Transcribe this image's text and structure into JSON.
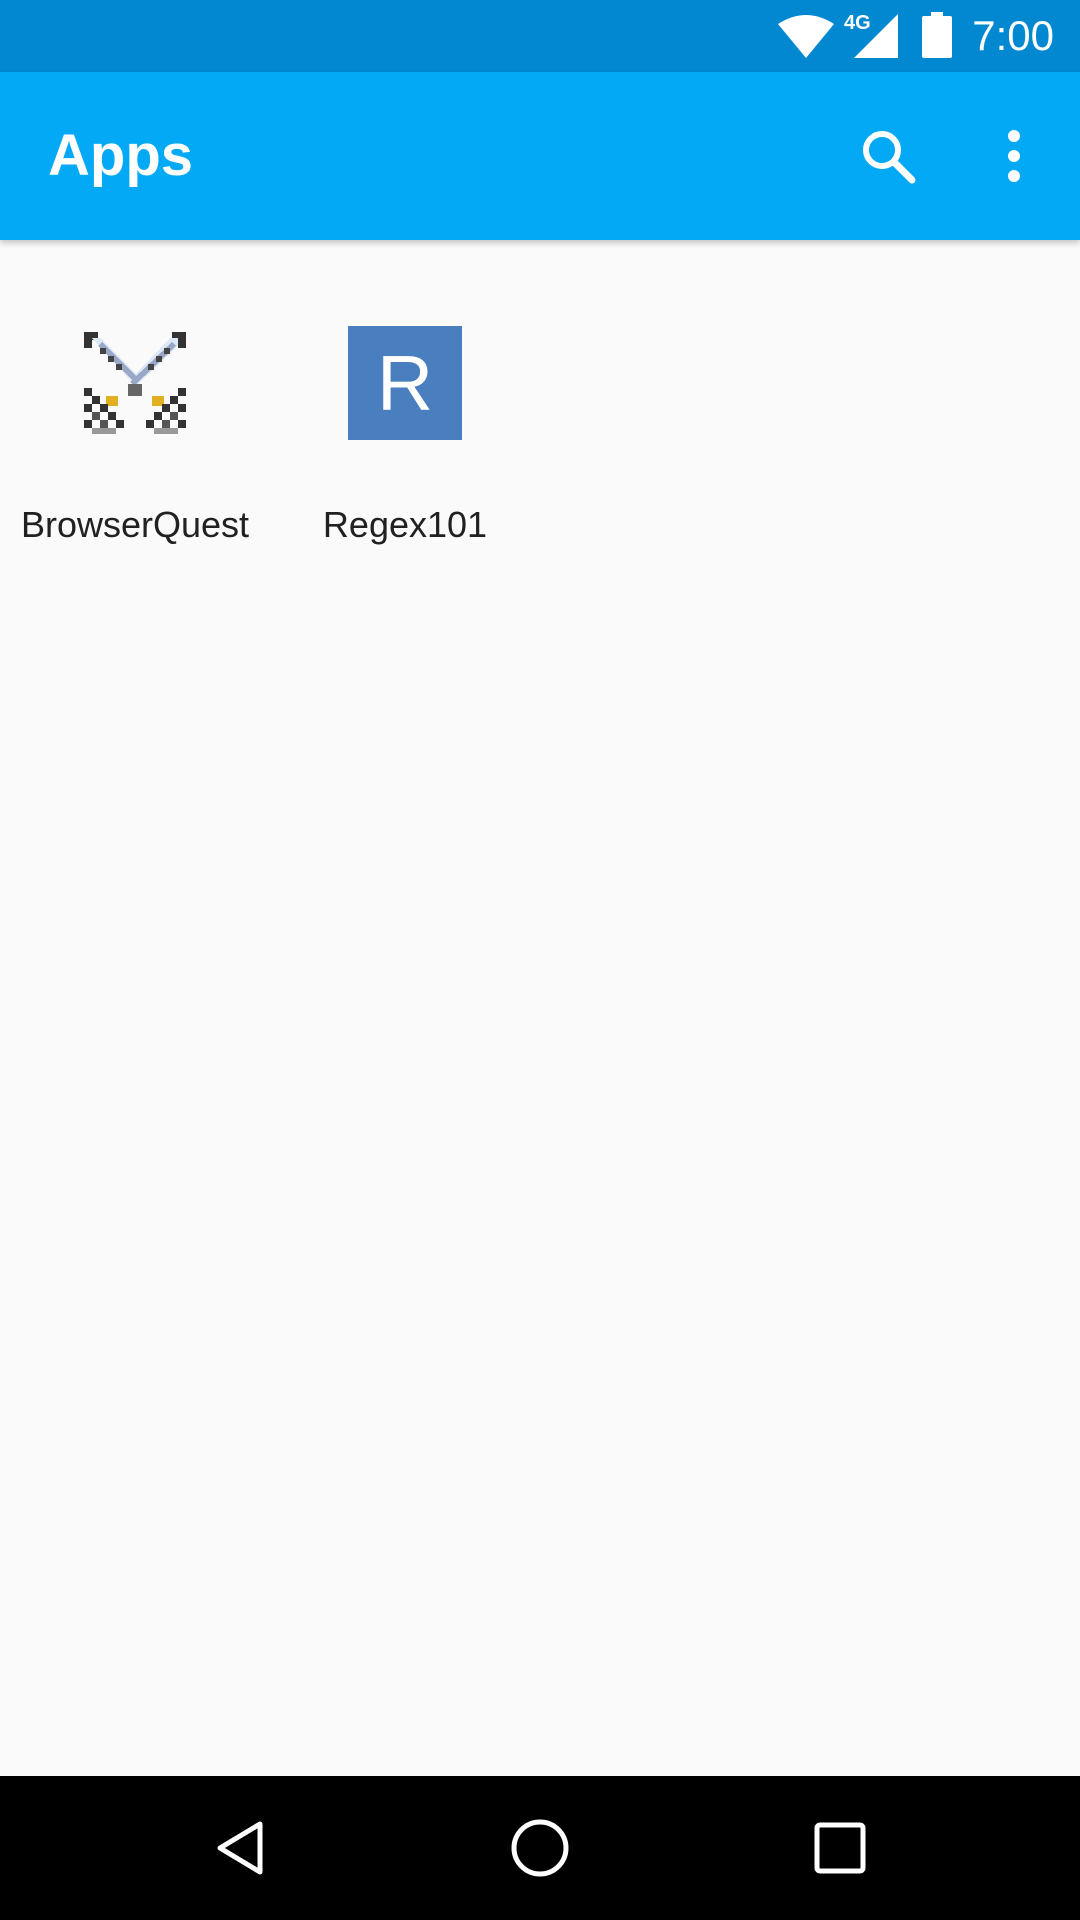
{
  "status_bar": {
    "time": "7:00",
    "network": "4G",
    "background": "#0288d1",
    "icons": [
      "wifi-icon",
      "cellular-signal-icon",
      "battery-icon"
    ]
  },
  "app_bar": {
    "title": "Apps",
    "background": "#03a9f4",
    "actions": [
      "search-icon",
      "more-options-icon"
    ]
  },
  "apps": [
    {
      "label": "BrowserQuest",
      "icon": "crossed-swords-icon"
    },
    {
      "label": "Regex101",
      "icon": "letter-icon",
      "icon_letter": "R",
      "icon_color": "#4a7fbf"
    }
  ],
  "nav_bar": {
    "buttons": [
      "back-icon",
      "home-icon",
      "recents-icon"
    ]
  }
}
